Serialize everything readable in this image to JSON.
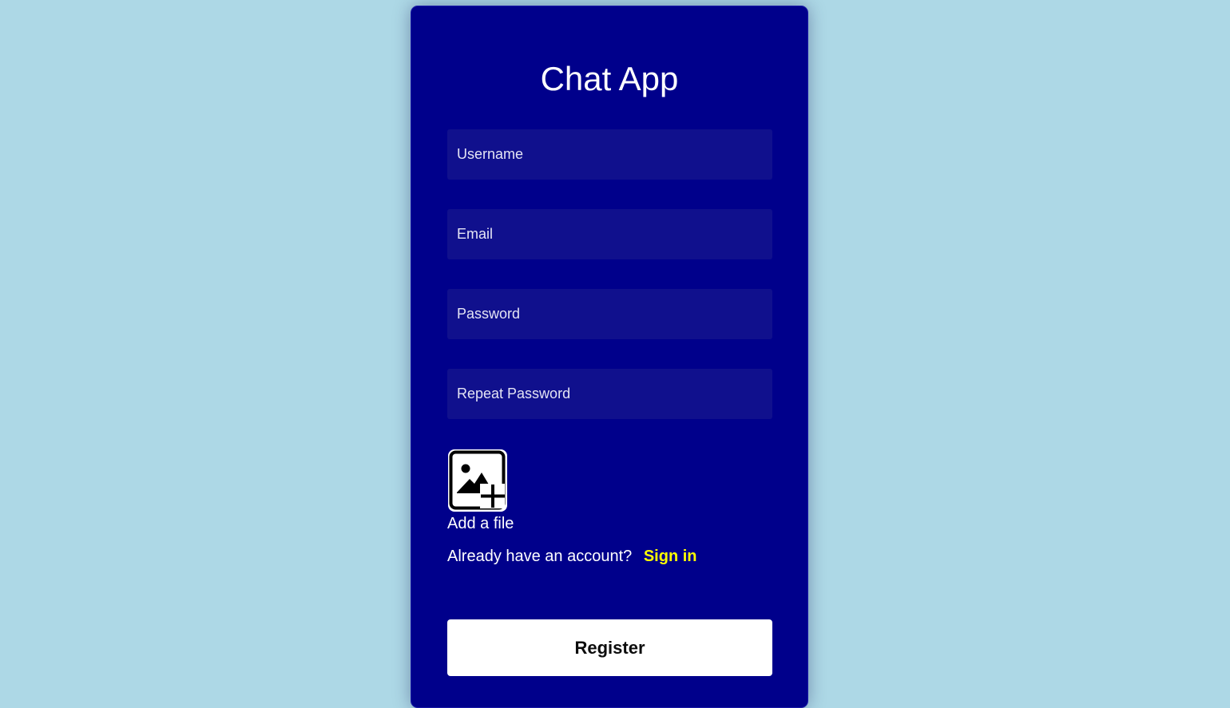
{
  "app": {
    "title": "Chat App"
  },
  "form": {
    "username": {
      "value": "",
      "placeholder": "Username"
    },
    "email": {
      "value": "",
      "placeholder": "Email"
    },
    "password": {
      "value": "",
      "placeholder": "Password"
    },
    "repeat_password": {
      "value": "",
      "placeholder": "Repeat Password"
    },
    "file": {
      "icon": "add-image-icon",
      "label": "Add a file"
    },
    "signin": {
      "prompt": "Already have an account?",
      "link_label": "Sign in"
    },
    "register_label": "Register"
  },
  "colors": {
    "page_background": "#add8e6",
    "card_background": "#00008b",
    "field_background": "#10108d",
    "link": "#ffff00",
    "button_background": "#ffffff"
  }
}
